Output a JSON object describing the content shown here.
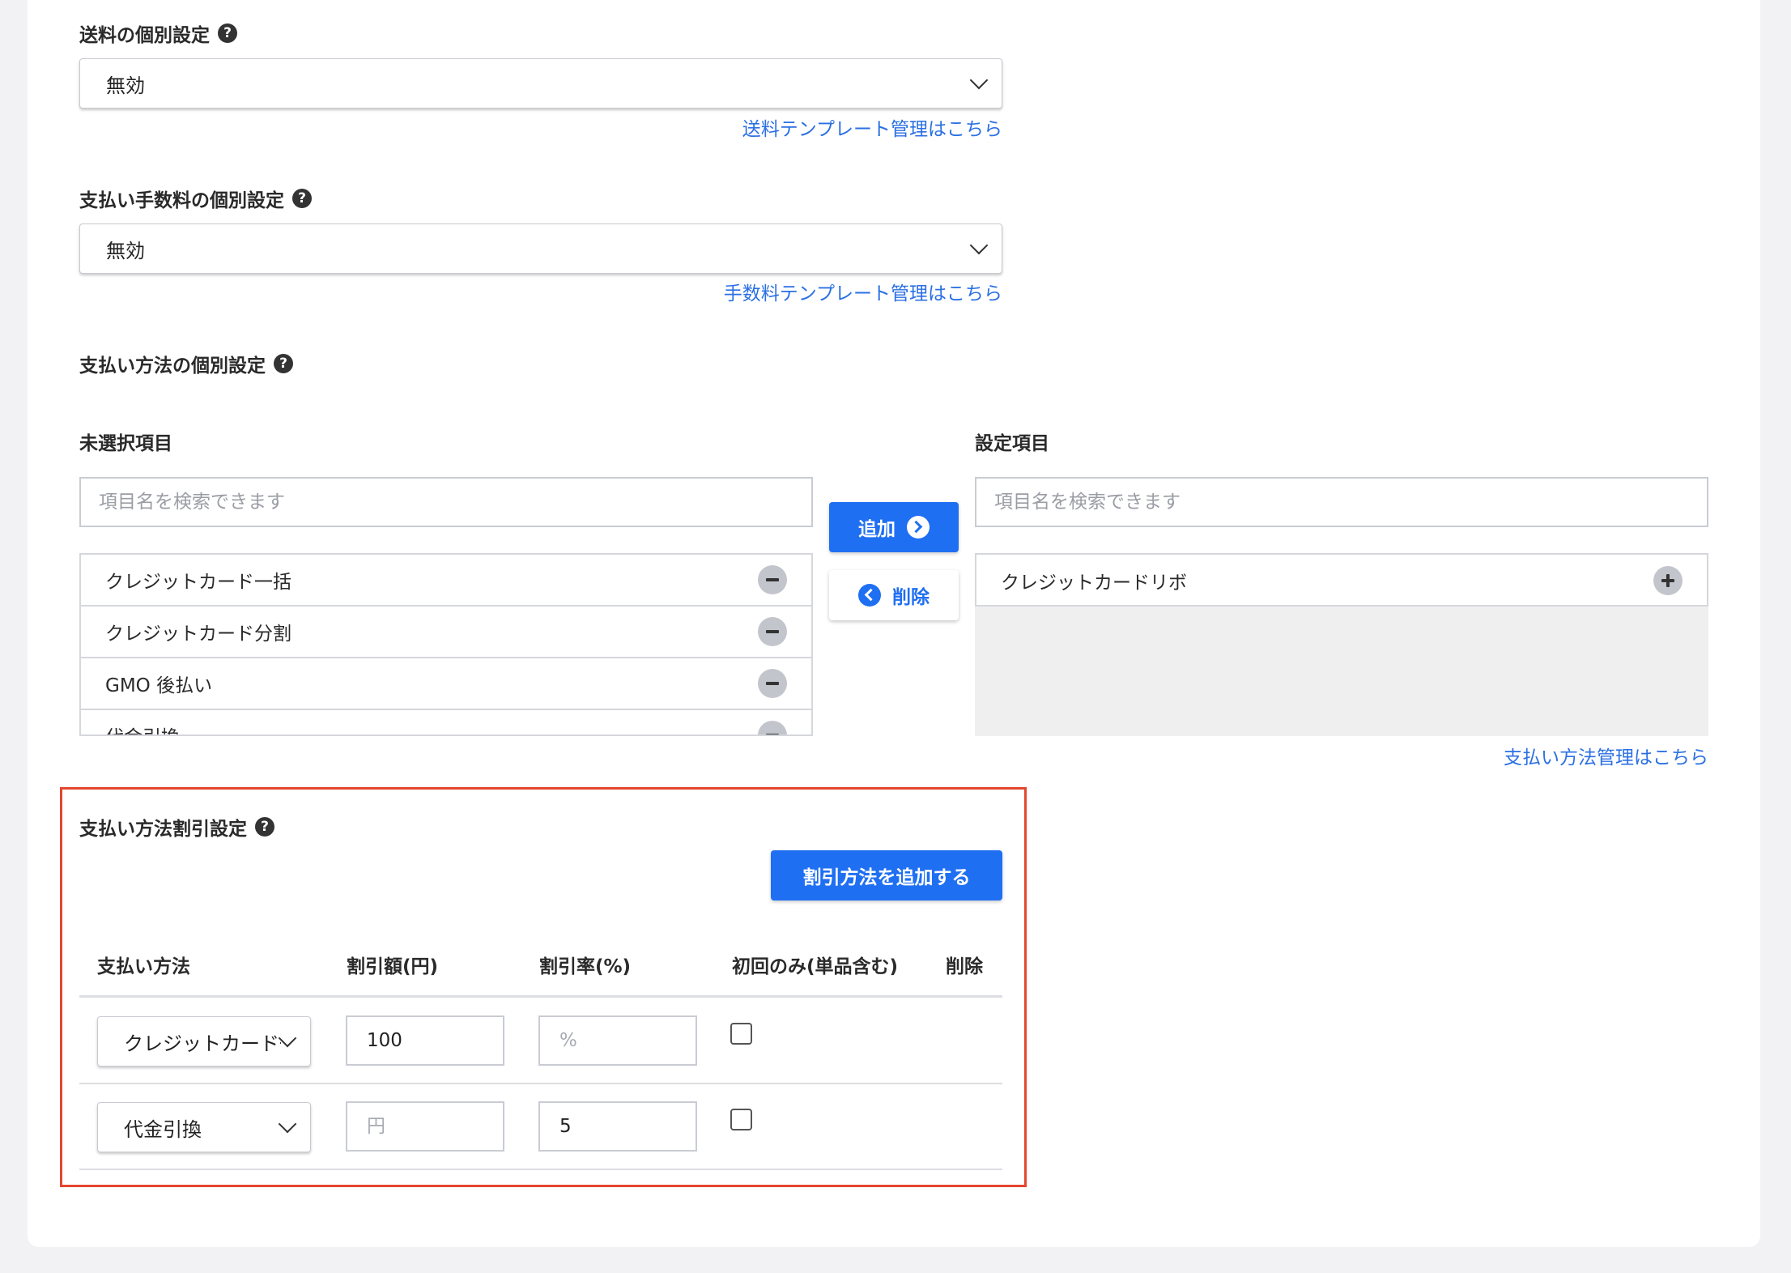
{
  "shipping": {
    "label": "送料の個別設定",
    "selected": "無効",
    "link": "送料テンプレート管理はこちら"
  },
  "payment_fee": {
    "label": "支払い手数料の個別設定",
    "selected": "無効",
    "link": "手数料テンプレート管理はこちら"
  },
  "payment_method": {
    "label": "支払い方法の個別設定",
    "unselected": {
      "title": "未選択項目",
      "search_placeholder": "項目名を検索できます",
      "items": [
        "クレジットカード一括",
        "クレジットカード分割",
        "GMO 後払い",
        "代金引換"
      ]
    },
    "add_button": "追加",
    "remove_button": "削除",
    "selected": {
      "title": "設定項目",
      "search_placeholder": "項目名を検索できます",
      "items": [
        "クレジットカードリボ"
      ]
    },
    "link": "支払い方法管理はこちら"
  },
  "discount": {
    "label": "支払い方法割引設定",
    "add_button": "割引方法を追加する",
    "headers": {
      "method": "支払い方法",
      "amount": "割引額(円)",
      "rate": "割引率(%)",
      "first_only": "初回のみ(単品含む)",
      "delete": "削除"
    },
    "rows": [
      {
        "method": "クレジットカード一",
        "amount": "100",
        "amount_placeholder": "円",
        "rate": "",
        "rate_placeholder": "%",
        "first_only": false
      },
      {
        "method": "代金引換",
        "amount": "",
        "amount_placeholder": "円",
        "rate": "5",
        "rate_placeholder": "%",
        "first_only": false
      }
    ]
  },
  "colors": {
    "primary": "#1f6ff2",
    "link": "#2b70e3",
    "highlight_border": "#e4462e",
    "background": "#f2f2f4"
  },
  "icons": {
    "help": "question-circle-icon",
    "dropdown": "chevron-down-icon",
    "add": "chevron-right-circle-icon",
    "remove": "chevron-left-circle-icon",
    "item_remove": "minus-circle-icon",
    "item_add": "plus-circle-icon"
  }
}
